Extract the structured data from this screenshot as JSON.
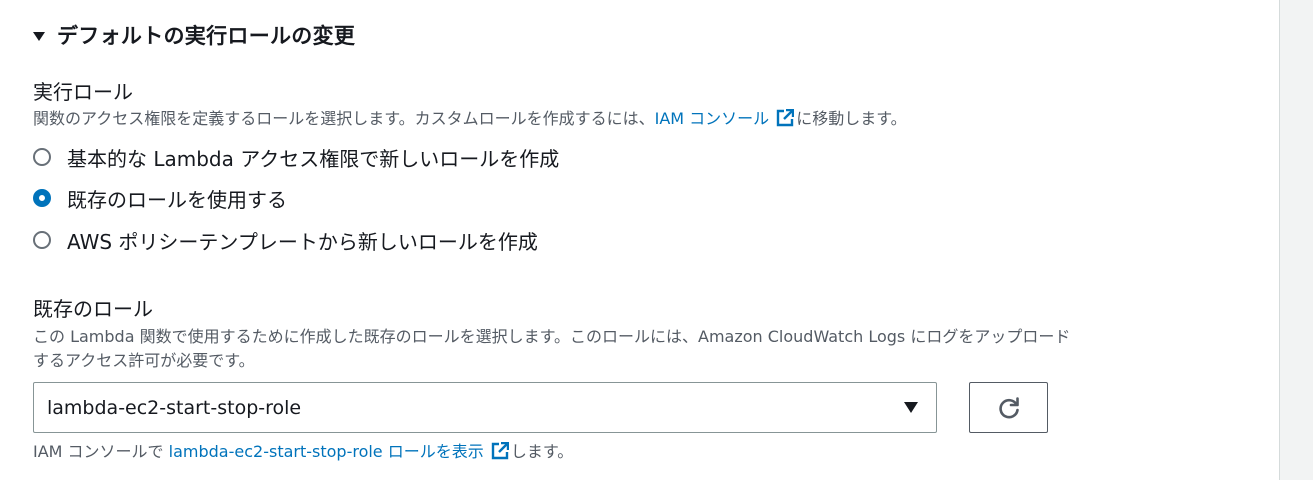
{
  "section": {
    "title": "デフォルトの実行ロールの変更"
  },
  "execution_role": {
    "label": "実行ロール",
    "description_before": "関数のアクセス権限を定義するロールを選択します。カスタムロールを作成するには、",
    "description_link": "IAM コンソール",
    "description_after": "に移動します。",
    "options": [
      {
        "label": "基本的な Lambda アクセス権限で新しいロールを作成",
        "checked": false
      },
      {
        "label": "既存のロールを使用する",
        "checked": true
      },
      {
        "label": "AWS ポリシーテンプレートから新しいロールを作成",
        "checked": false
      }
    ]
  },
  "existing_role": {
    "label": "既存のロール",
    "description_line1": "この Lambda 関数で使用するために作成した既存のロールを選択します。このロールには、Amazon CloudWatch Logs にログをアップロード",
    "description_line2": "するアクセス許可が必要です。",
    "selected_value": "lambda-ec2-start-stop-role",
    "helper_before": "IAM コンソールで ",
    "helper_link": "lambda-ec2-start-stop-role ロールを表示",
    "helper_after": "します。"
  },
  "icons": {
    "external_link": "external-link-icon",
    "refresh": "refresh-icon"
  },
  "colors": {
    "link": "#0073bb",
    "text": "#16191f",
    "muted": "#545b64"
  }
}
